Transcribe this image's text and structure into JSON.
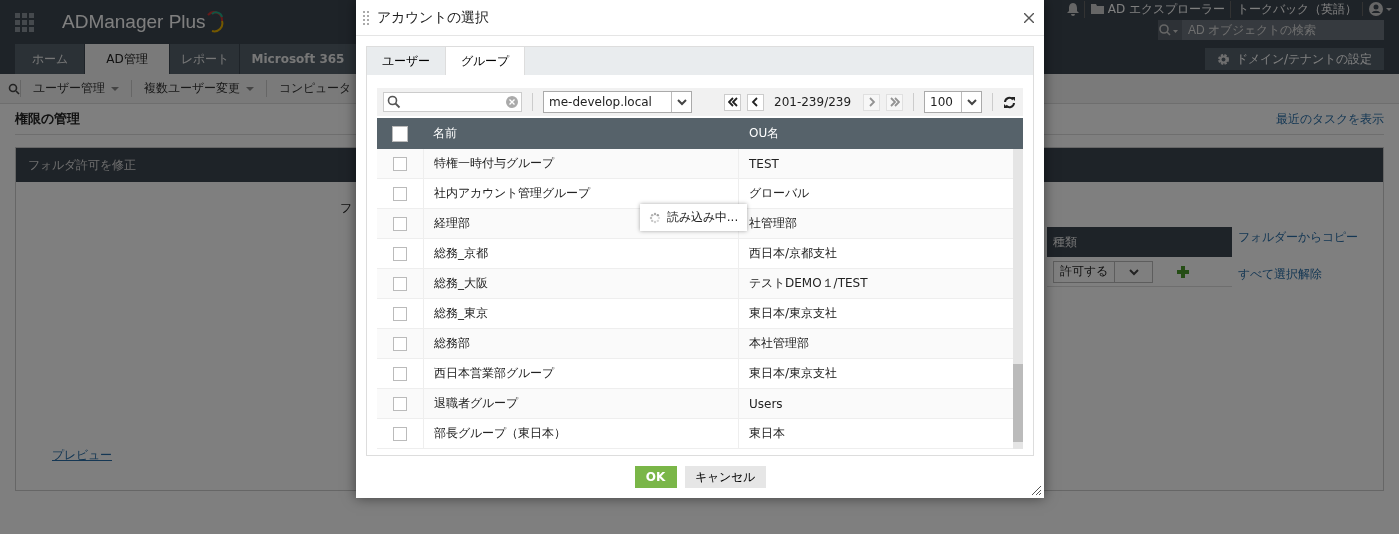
{
  "app": {
    "logo": "ADManager Plus",
    "nav_tabs": [
      {
        "label": "ホーム",
        "selected": false
      },
      {
        "label": "AD管理",
        "selected": true
      },
      {
        "label": "レポート",
        "selected": false
      },
      {
        "label": "Microsoft 365",
        "selected": false
      }
    ],
    "top_links": [
      {
        "kind": "explorer",
        "label": "AD エクスプローラー"
      },
      {
        "kind": "plain",
        "label": "トークバック（英語）"
      }
    ],
    "search": {
      "placeholder": "AD オブジェクトの検索"
    },
    "domain_button": "ドメイン/テナントの設定"
  },
  "sub_nav": [
    {
      "label": "ユーザー管理",
      "has_menu": true
    },
    {
      "label": "複数ユーザー変更",
      "has_menu": true
    },
    {
      "label": "コンピュータ",
      "has_menu": false
    }
  ],
  "page": {
    "title": "権限の管理",
    "recent_link": "最近のタスクを表示",
    "panel": {
      "title": "フォルダ許可を修正",
      "partial_text": "フ",
      "type_column": "種類",
      "type_select": "許可する",
      "copy_link": "フォルダーからコピー",
      "clear_link": "すべて選択解除",
      "preview_link": "プレビュー"
    }
  },
  "dialog": {
    "title": "アカウントの選択",
    "tabs": [
      {
        "label": "ユーザー",
        "selected": false
      },
      {
        "label": "グループ",
        "selected": true
      }
    ],
    "domain": "me-develop.local",
    "pager": [
      {
        "kind": "first",
        "disabled": false
      },
      {
        "kind": "prev",
        "disabled": false
      },
      {
        "kind": "next",
        "disabled": true
      },
      {
        "kind": "last",
        "disabled": true
      }
    ],
    "page_range": "201-239/239",
    "page_size": "100",
    "columns": [
      "名前",
      "OU名"
    ],
    "all_checked": false,
    "rows": [
      {
        "name": "特権一時付与グループ",
        "ou": "TEST",
        "checked": false
      },
      {
        "name": "社内アカウント管理グループ",
        "ou": "グローバル",
        "checked": false
      },
      {
        "name": "経理部",
        "ou": "社管理部",
        "checked": false
      },
      {
        "name": "総務_京都",
        "ou": "西日本/京都支社",
        "checked": false
      },
      {
        "name": "総務_大阪",
        "ou": "テストDEMO１/TEST",
        "checked": false
      },
      {
        "name": "総務_東京",
        "ou": "東日本/東京支社",
        "checked": false
      },
      {
        "name": "総務部",
        "ou": "本社管理部",
        "checked": false
      },
      {
        "name": "西日本営業部グループ",
        "ou": "東日本/東京支社",
        "checked": false
      },
      {
        "name": "退職者グループ",
        "ou": "Users",
        "checked": false
      },
      {
        "name": "部長グループ（東日本）",
        "ou": "東日本",
        "checked": false
      }
    ],
    "loading": "読み込み中...",
    "ok": "OK",
    "cancel": "キャンセル"
  }
}
